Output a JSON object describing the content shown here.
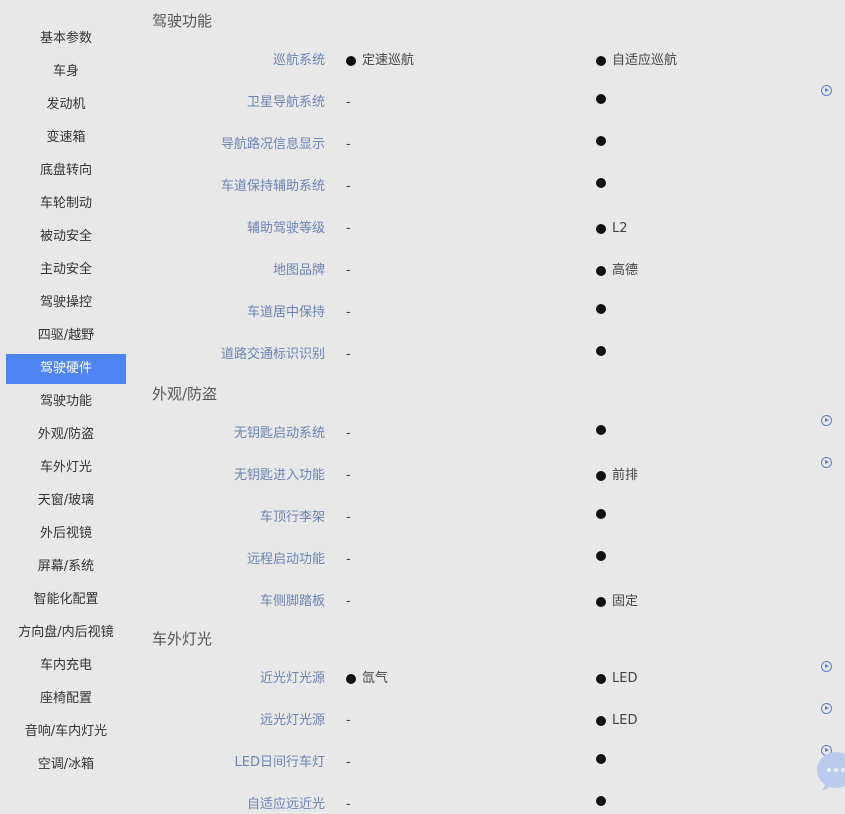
{
  "sidebar": {
    "items": [
      {
        "label": "基本参数"
      },
      {
        "label": "车身"
      },
      {
        "label": "发动机"
      },
      {
        "label": "变速箱"
      },
      {
        "label": "底盘转向"
      },
      {
        "label": "车轮制动"
      },
      {
        "label": "被动安全"
      },
      {
        "label": "主动安全"
      },
      {
        "label": "驾驶操控"
      },
      {
        "label": "四驱/越野"
      },
      {
        "label": "驾驶硬件"
      },
      {
        "label": "驾驶功能"
      },
      {
        "label": "外观/防盗"
      },
      {
        "label": "车外灯光"
      },
      {
        "label": "天窗/玻璃"
      },
      {
        "label": "外后视镜"
      },
      {
        "label": "屏幕/系统"
      },
      {
        "label": "智能化配置"
      },
      {
        "label": "方向盘/内后视镜"
      },
      {
        "label": "车内充电"
      },
      {
        "label": "座椅配置"
      },
      {
        "label": "音响/车内灯光"
      },
      {
        "label": "空调/冰箱"
      }
    ],
    "active_index": 10
  },
  "sections": [
    {
      "title": "驾驶功能",
      "rows": [
        {
          "label": "巡航系统",
          "c1": {
            "dot": true,
            "text": "定速巡航"
          },
          "c2": {
            "dot": true,
            "text": "自适应巡航"
          }
        },
        {
          "label": "卫星导航系统",
          "c1": {
            "dot": false,
            "text": "-"
          },
          "c2": {
            "dot": true,
            "text": ""
          }
        },
        {
          "label": "导航路况信息显示",
          "c1": {
            "dot": false,
            "text": "-"
          },
          "c2": {
            "dot": true,
            "text": ""
          }
        },
        {
          "label": "车道保持辅助系统",
          "c1": {
            "dot": false,
            "text": "-"
          },
          "c2": {
            "dot": true,
            "text": ""
          }
        },
        {
          "label": "辅助驾驶等级",
          "c1": {
            "dot": false,
            "text": "-"
          },
          "c2": {
            "dot": true,
            "text": "L2"
          }
        },
        {
          "label": "地图品牌",
          "c1": {
            "dot": false,
            "text": "-"
          },
          "c2": {
            "dot": true,
            "text": "高德"
          }
        },
        {
          "label": "车道居中保持",
          "c1": {
            "dot": false,
            "text": "-"
          },
          "c2": {
            "dot": true,
            "text": ""
          }
        },
        {
          "label": "道路交通标识识别",
          "c1": {
            "dot": false,
            "text": "-"
          },
          "c2": {
            "dot": true,
            "text": ""
          }
        }
      ]
    },
    {
      "title": "外观/防盗",
      "rows": [
        {
          "label": "无钥匙启动系统",
          "c1": {
            "dot": false,
            "text": "-"
          },
          "c2": {
            "dot": true,
            "text": ""
          }
        },
        {
          "label": "无钥匙进入功能",
          "c1": {
            "dot": false,
            "text": "-"
          },
          "c2": {
            "dot": true,
            "text": "前排"
          }
        },
        {
          "label": "车顶行李架",
          "c1": {
            "dot": false,
            "text": "-"
          },
          "c2": {
            "dot": true,
            "text": ""
          }
        },
        {
          "label": "远程启动功能",
          "c1": {
            "dot": false,
            "text": "-"
          },
          "c2": {
            "dot": true,
            "text": ""
          }
        },
        {
          "label": "车侧脚踏板",
          "c1": {
            "dot": false,
            "text": "-"
          },
          "c2": {
            "dot": true,
            "text": "固定"
          }
        }
      ]
    },
    {
      "title": "车外灯光",
      "rows": [
        {
          "label": "近光灯光源",
          "c1": {
            "dot": true,
            "text": "氙气"
          },
          "c2": {
            "dot": true,
            "text": "LED"
          }
        },
        {
          "label": "远光灯光源",
          "c1": {
            "dot": false,
            "text": "-"
          },
          "c2": {
            "dot": true,
            "text": "LED"
          }
        },
        {
          "label": "LED日间行车灯",
          "c1": {
            "dot": false,
            "text": "-"
          },
          "c2": {
            "dot": true,
            "text": ""
          }
        },
        {
          "label": "自适应远近光",
          "c1": {
            "dot": false,
            "text": "-"
          },
          "c2": {
            "dot": true,
            "text": ""
          }
        }
      ]
    }
  ],
  "side_icons": [
    "play-circle-icon",
    "play-circle-icon",
    "play-circle-icon",
    "play-circle-icon",
    "play-circle-icon",
    "play-circle-icon"
  ],
  "colors": {
    "background": "#e8e8e8",
    "active_nav": "#4e84f3",
    "row_label": "#6b84b5",
    "icon_accent": "#5b7fd6"
  }
}
